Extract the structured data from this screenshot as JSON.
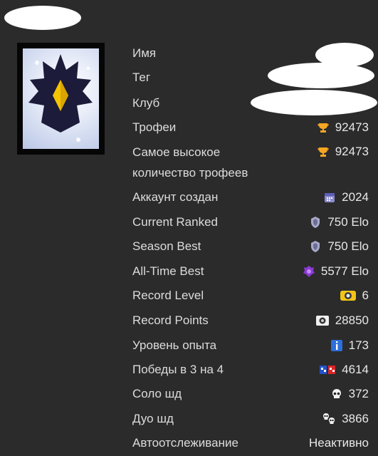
{
  "labels": {
    "name": "Имя",
    "tag": "Тег",
    "club": "Клуб",
    "trophies": "Трофеи",
    "highest_trophies": "Самое высокое количество трофеев",
    "account_created": "Аккаунт создан",
    "current_ranked": "Current Ranked",
    "season_best": "Season Best",
    "all_time_best": "All-Time Best",
    "record_level": "Record Level",
    "record_points": "Record Points",
    "exp_level": "Уровень опыта",
    "wins_3v3": "Победы в 3 на 4",
    "solo_sd": "Соло шд",
    "duo_sd": "Дуо шд",
    "autotrack": "Автоотслеживание"
  },
  "values": {
    "trophies": "92473",
    "highest_trophies": "92473",
    "account_created": "2024",
    "current_ranked": "750 Elo",
    "season_best": "750 Elo",
    "all_time_best": "5577 Elo",
    "record_level": "6",
    "record_points": "28850",
    "exp_level": "173",
    "wins_3v3": "4614",
    "solo_sd": "372",
    "duo_sd": "3866",
    "autotrack": "Неактивно"
  },
  "icons": {
    "trophies": "trophy-icon",
    "highest_trophies": "trophy-icon",
    "account_created": "calendar-icon",
    "current_ranked": "ranked-icon",
    "season_best": "ranked-icon",
    "all_time_best": "masters-icon",
    "record_level": "record-level-icon",
    "record_points": "record-points-icon",
    "exp_level": "info-icon",
    "wins_3v3": "3v3-icon",
    "solo_sd": "skull-icon",
    "duo_sd": "duo-skull-icon"
  },
  "colors": {
    "background": "#2b2b2b",
    "text": "#dcdcdc",
    "trophy": "#f5a623",
    "info": "#2d6fdc",
    "masters": "#8a3ad6"
  }
}
